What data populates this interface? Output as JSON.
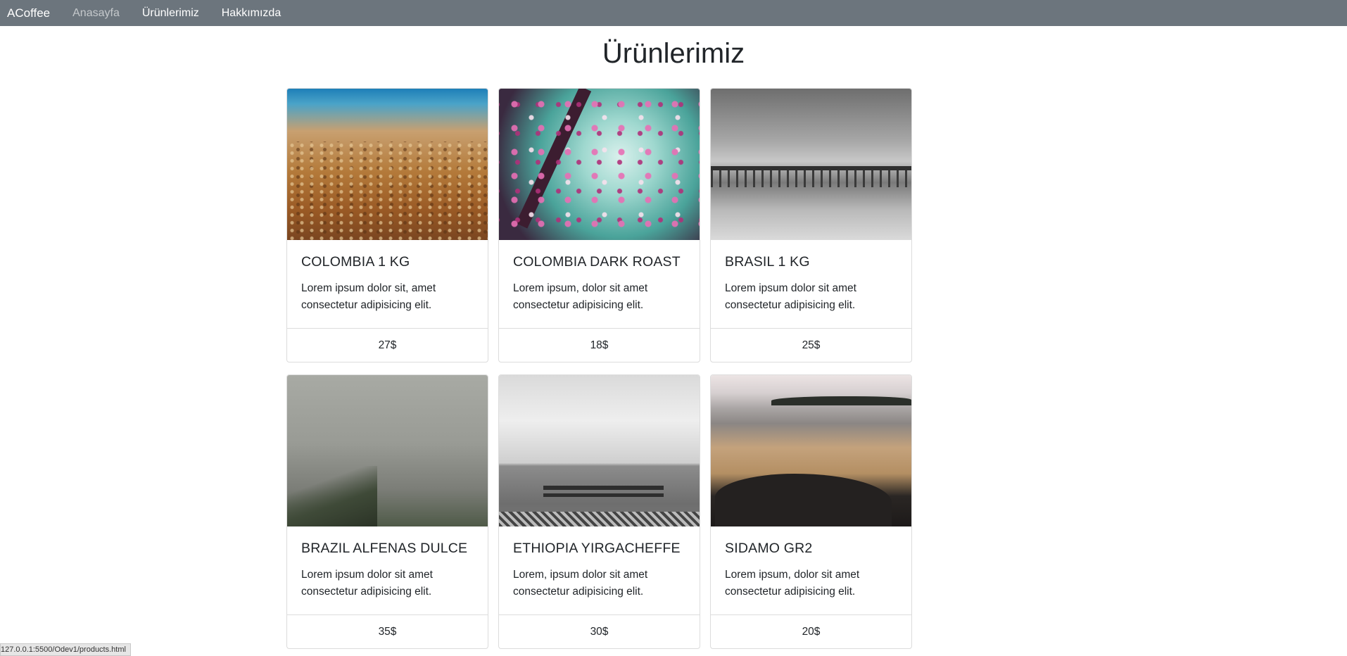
{
  "nav": {
    "brand": "ACoffee",
    "links": [
      {
        "label": "Anasayfa"
      },
      {
        "label": "Ürünlerimiz"
      },
      {
        "label": "Hakkımızda"
      }
    ]
  },
  "main": {
    "title": "Ürünlerimiz",
    "products": [
      {
        "name": "COLOMBIA 1 KG",
        "description": "Lorem ipsum dolor sit, amet consectetur adipisicing elit.",
        "price": "27$",
        "image": "beach-pebbles-image"
      },
      {
        "name": "COLOMBIA DARK ROAST",
        "description": "Lorem ipsum, dolor sit amet consectetur adipisicing elit.",
        "price": "18$",
        "image": "cherry-blossom-image"
      },
      {
        "name": "BRASIL 1 KG",
        "description": "Lorem ipsum dolor sit amet consectetur adipisicing elit.",
        "price": "25$",
        "image": "pier-image"
      },
      {
        "name": "BRAZIL ALFENAS DULCE",
        "description": "Lorem ipsum dolor sit amet consectetur adipisicing elit.",
        "price": "35$",
        "image": "foggy-beach-image"
      },
      {
        "name": "ETHIOPIA YIRGACHEFFE",
        "description": "Lorem, ipsum dolor sit amet consectetur adipisicing elit.",
        "price": "30$",
        "image": "bench-wall-image"
      },
      {
        "name": "SIDAMO GR2",
        "description": "Lorem ipsum, dolor sit amet consectetur adipisicing elit.",
        "price": "20$",
        "image": "rocky-shore-image"
      }
    ]
  },
  "status_bar": {
    "url": "127.0.0.1:5500/Odev1/products.html"
  }
}
